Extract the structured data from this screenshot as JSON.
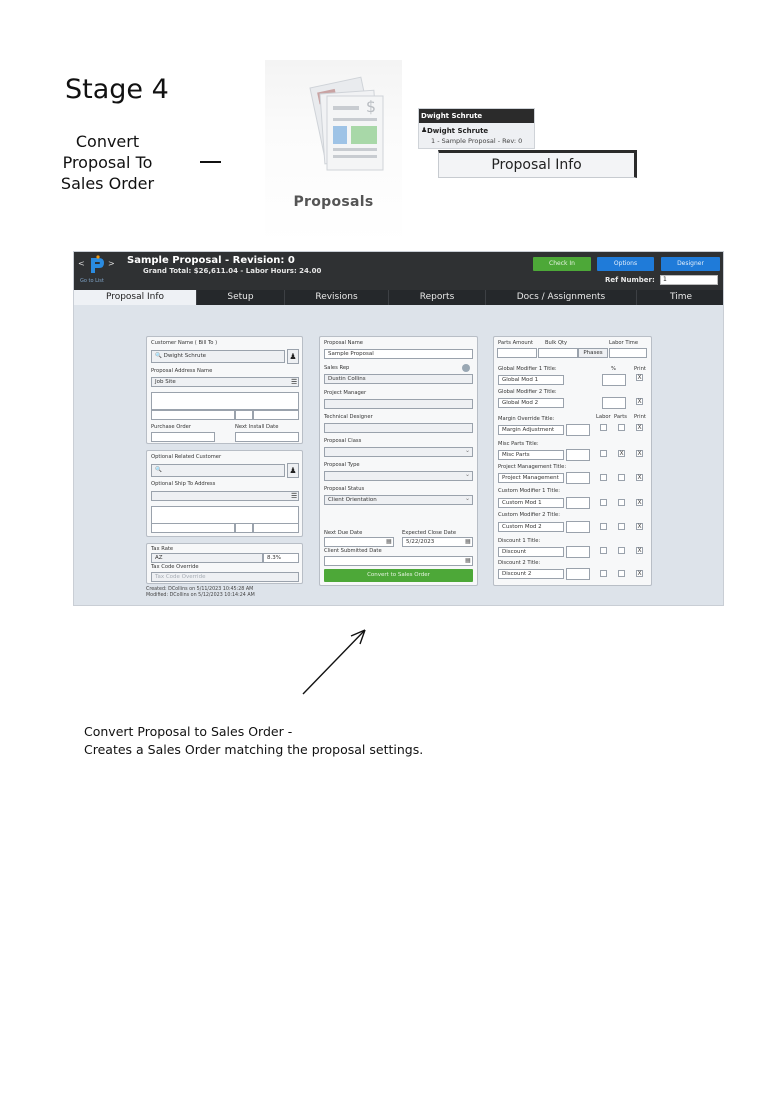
{
  "doc": {
    "stage_title": "Stage 4",
    "convert_lines": [
      "Convert",
      "Proposal To",
      "Sales Order"
    ],
    "proposals_label": "Proposals",
    "user_panel": {
      "header": "Dwight Schrute",
      "name": "Dwight Schrute",
      "sub": "1 - Sample Proposal - Rev: 0"
    },
    "proposal_info_tab": "Proposal Info",
    "bottom_line1": "Convert Proposal to Sales Order -",
    "bottom_line2": "Creates a Sales Order matching the proposal settings."
  },
  "app": {
    "nav_left": "<",
    "nav_right": ">",
    "go_to_list": "Go to List",
    "title": "Sample Proposal - Revision: 0",
    "grand_total": "Grand Total: $26,611.04  -  Labor Hours: 24.00",
    "check_in": "Check In",
    "options": "Options",
    "designer": "Designer",
    "ref_label": "Ref Number:",
    "ref_value": "1",
    "tabs": [
      "Proposal Info",
      "Setup",
      "Revisions",
      "Reports",
      "Docs / Assignments",
      "Time"
    ],
    "left": {
      "customer_name_label": "Customer Name ( Bill To )",
      "customer_name": "Dwight Schrute",
      "address_name_label": "Proposal Address Name",
      "address_name": "Job Site",
      "purchase_order_label": "Purchase Order",
      "next_install_label": "Next Install Date",
      "related_customer_label": "Optional Related Customer",
      "ship_to_label": "Optional Ship To Address",
      "tax_rate_label": "Tax Rate",
      "tax_rate_state": "AZ",
      "tax_rate_value": "8.3%",
      "tax_override_label": "Tax Code Override",
      "tax_override_placeholder": "Tax Code Override",
      "created": "Created: DCollins on 5/11/2023 10:45:28 AM",
      "modified": "Modified: DCollins on 5/12/2023 10:14:24 AM"
    },
    "middle": {
      "proposal_name_label": "Proposal Name",
      "proposal_name": "Sample Proposal",
      "sales_rep_label": "Sales Rep",
      "sales_rep": "Dustin Collins",
      "project_manager_label": "Project Manager",
      "tech_designer_label": "Technical Designer",
      "class_label": "Proposal Class",
      "type_label": "Proposal Type",
      "status_label": "Proposal Status",
      "status": "Client Orientation",
      "next_due_label": "Next Due Date",
      "expected_close_label": "Expected Close Date",
      "expected_close": "5/22/2023",
      "client_submitted_label": "Client Submitted Date",
      "convert_button": "Convert to Sales Order"
    },
    "right": {
      "parts_amount_label": "Parts Amount",
      "bulk_qty_label": "Bulk Qty",
      "labor_time_label": "Labor Time",
      "phases_button": "Phases",
      "pct_label": "%",
      "print_label": "Print",
      "labor_label": "Labor",
      "parts_label": "Parts",
      "rows": [
        {
          "title_label": "Global Modifier 1 Title:",
          "value": "Global Mod 1"
        },
        {
          "title_label": "Global Modifier 2 Title:",
          "value": "Global Mod 2"
        },
        {
          "title_label": "Margin Override Title:",
          "value": "Margin Adjustment"
        },
        {
          "title_label": "Misc Parts Title:",
          "value": "Misc Parts"
        },
        {
          "title_label": "Project Management Title:",
          "value": "Project Management"
        },
        {
          "title_label": "Custom Modifier 1 Title:",
          "value": "Custom Mod 1"
        },
        {
          "title_label": "Custom Modifier 2 Title:",
          "value": "Custom Mod 2"
        },
        {
          "title_label": "Discount 1 Title:",
          "value": "Discount"
        },
        {
          "title_label": "Discount 2 Title:",
          "value": "Discount 2"
        }
      ],
      "check_mark": "X"
    }
  },
  "colors": {
    "header_bg": "#2f3133",
    "accent_green": "#4da838",
    "accent_blue": "#1f7bd9",
    "content_bg": "#dde3ea"
  }
}
